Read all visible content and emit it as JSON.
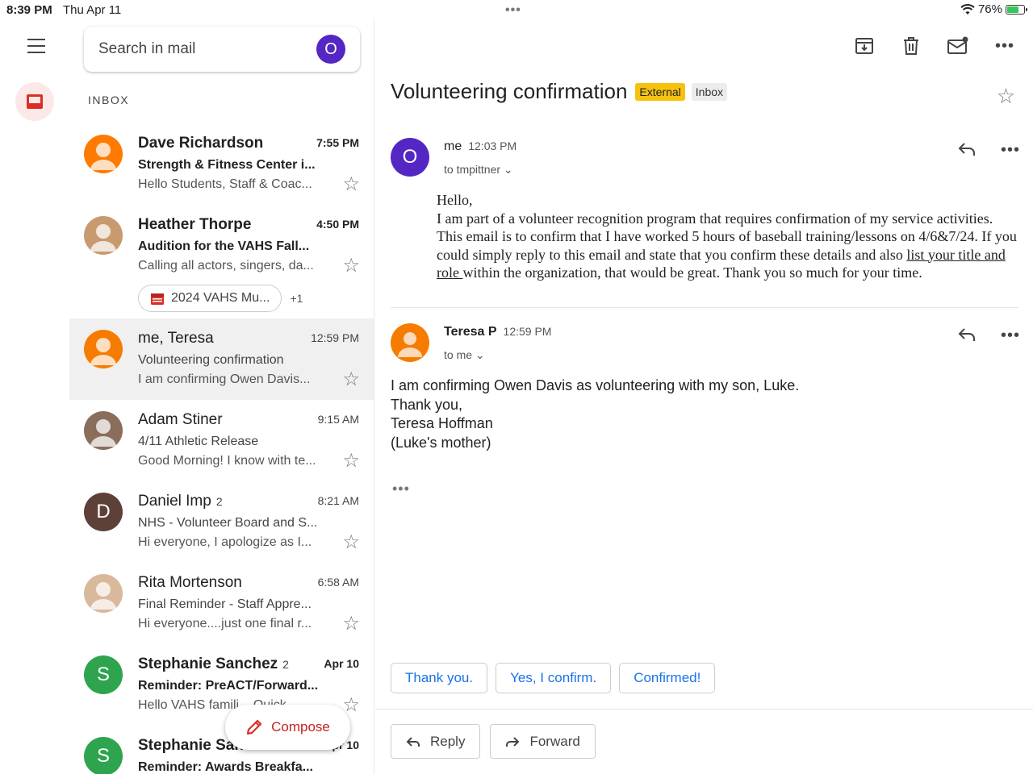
{
  "status": {
    "time": "8:39 PM",
    "date": "Thu Apr 11",
    "battery": "76%",
    "battery_level": 0.76
  },
  "search": {
    "placeholder": "Search in mail",
    "avatar_letter": "O"
  },
  "list": {
    "section": "INBOX",
    "rows": [
      {
        "sender": "Dave Richardson",
        "count": "",
        "time": "7:55 PM",
        "subject": "Strength & Fitness Center i...",
        "snippet": "Hello Students, Staff & Coac...",
        "unread": true,
        "avatar_letter": "",
        "avatar_color": "#ff7a00"
      },
      {
        "sender": "Heather Thorpe",
        "count": "",
        "time": "4:50 PM",
        "subject": "Audition for the VAHS Fall...",
        "snippet": "Calling all actors, singers, da...",
        "unread": true,
        "avatar_letter": "",
        "avatar_color": "#c89a6f",
        "chip": "2024 VAHS Mu...",
        "chip_more": "+1"
      },
      {
        "sender": "me, Teresa",
        "count": "",
        "time": "12:59 PM",
        "subject": "Volunteering confirmation",
        "snippet": "I am confirming Owen Davis...",
        "unread": false,
        "avatar_letter": "",
        "avatar_color": "#f57c00"
      },
      {
        "sender": "Adam Stiner",
        "count": "",
        "time": "9:15 AM",
        "subject": "4/11 Athletic Release",
        "snippet": "Good Morning! I know with te...",
        "unread": false,
        "avatar_letter": "",
        "avatar_color": "#8a6d5b"
      },
      {
        "sender": "Daniel Imp",
        "count": "2",
        "time": "8:21 AM",
        "subject": "NHS - Volunteer Board and S...",
        "snippet": "Hi everyone, I apologize as I...",
        "unread": false,
        "avatar_letter": "D",
        "avatar_color": "#5d4037"
      },
      {
        "sender": "Rita Mortenson",
        "count": "",
        "time": "6:58 AM",
        "subject": "Final Reminder - Staff Appre...",
        "snippet": "Hi everyone....just one final r...",
        "unread": false,
        "avatar_letter": "",
        "avatar_color": "#d9b99b"
      },
      {
        "sender": "Stephanie Sanchez",
        "count": "2",
        "time": "Apr 10",
        "subject": "Reminder: PreACT/Forward...",
        "snippet": "Hello VAHS famili... Quick...",
        "unread": true,
        "avatar_letter": "S",
        "avatar_color": "#2ea44f"
      },
      {
        "sender": "Stephanie Sanchez",
        "count": "",
        "time": "Apr 10",
        "subject": "Reminder: Awards Breakfa...",
        "snippet": "",
        "unread": true,
        "avatar_letter": "S",
        "avatar_color": "#2ea44f"
      }
    ]
  },
  "compose": {
    "label": "Compose"
  },
  "thread": {
    "subject": "Volunteering confirmation",
    "tag_external": "External",
    "tag_inbox": "Inbox",
    "msg1": {
      "from": "me",
      "time": "12:03 PM",
      "to": "to tmpittner",
      "avatar_letter": "O",
      "greeting": "Hello,",
      "body_a": "I am part of a volunteer recognition program that requires confirmation of my service activities. This email is to confirm that I have worked 5 hours of baseball training/lessons on 4/6&7/24. If you could simply reply to this email and state that you confirm these details and also ",
      "body_link": "list your title and role ",
      "body_b": "within the organization, that would be great. Thank you so much for your time."
    },
    "msg2": {
      "from": "Teresa P",
      "time": "12:59 PM",
      "to": "to me",
      "lines": [
        "I am confirming Owen Davis as volunteering with my son, Luke.",
        "Thank you,",
        "Teresa Hoffman",
        "(Luke's mother)"
      ]
    },
    "smart_replies": [
      "Thank you.",
      "Yes, I confirm.",
      "Confirmed!"
    ],
    "reply_label": "Reply",
    "forward_label": "Forward"
  },
  "colors": {
    "accent": "#1a73e8",
    "compose_red": "#c5221f",
    "external_tag": "#f6c20f",
    "avatar_purple": "#5426c3"
  }
}
